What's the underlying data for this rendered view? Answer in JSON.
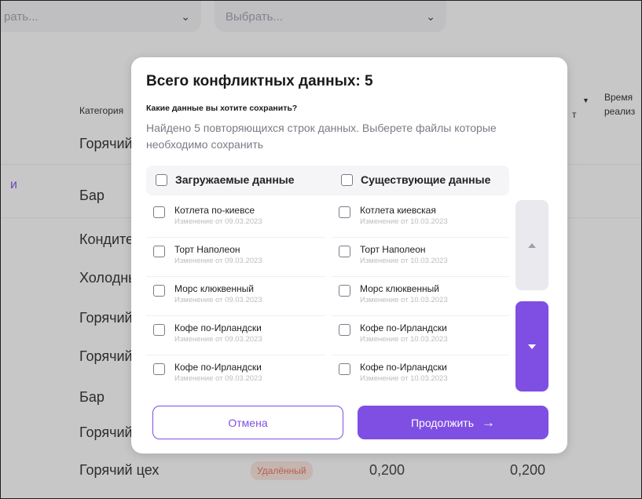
{
  "background": {
    "filter1_placeholder": "рать...",
    "filter2_placeholder": "Выбрать...",
    "column_category": "Категория",
    "column_partial": "т",
    "column_time_line1": "Время",
    "column_time_line2": "реализ",
    "left_accent": "и",
    "rows": [
      "Горячий цех",
      "Бар",
      "Кондитерский",
      "Холодный цех",
      "Горячий цех",
      "Горячий цех",
      "Бар",
      "Горячий цех",
      "Горячий цех"
    ],
    "status_badge": "Удалённый",
    "value1": "0,200",
    "value2": "0,200"
  },
  "modal": {
    "title": "Всего конфликтных данных: 5",
    "question": "Какие данные вы хотите сохранить?",
    "description": "Найдено 5 повторяющихся строк данных. Выберете файлы которые необходимо сохранить",
    "col_uploaded": "Загружаемые данные",
    "col_existing": "Существующие данные",
    "rows": [
      {
        "uploaded_name": "Котлета по-киевсе",
        "uploaded_date": "Изменение от 09.03.2023",
        "existing_name": "Котлета киевская",
        "existing_date": "Изменение от 10.03.2023"
      },
      {
        "uploaded_name": "Торт Наполеон",
        "uploaded_date": "Изменение от 09.03.2023",
        "existing_name": "Торт Наполеон",
        "existing_date": "Изменение от 10.03.2023"
      },
      {
        "uploaded_name": "Морс клюквенный",
        "uploaded_date": "Изменение от 09.03.2023",
        "existing_name": "Морс клюквенный",
        "existing_date": "Изменение от 10.03.2023"
      },
      {
        "uploaded_name": "Кофе по-Ирландски",
        "uploaded_date": "Изменение от 09.03.2023",
        "existing_name": "Кофе по-Ирландски",
        "existing_date": "Изменение от 10.03.2023"
      },
      {
        "uploaded_name": "Кофе по-Ирландски",
        "uploaded_date": "Изменение от 09.03.2023",
        "existing_name": "Кофе по-Ирландски",
        "existing_date": "Изменение от 10.03.2023"
      }
    ],
    "cancel_label": "Отмена",
    "continue_label": "Продолжить",
    "continue_icon": "arrow-right-icon",
    "accent_color": "#7f4fe3"
  }
}
